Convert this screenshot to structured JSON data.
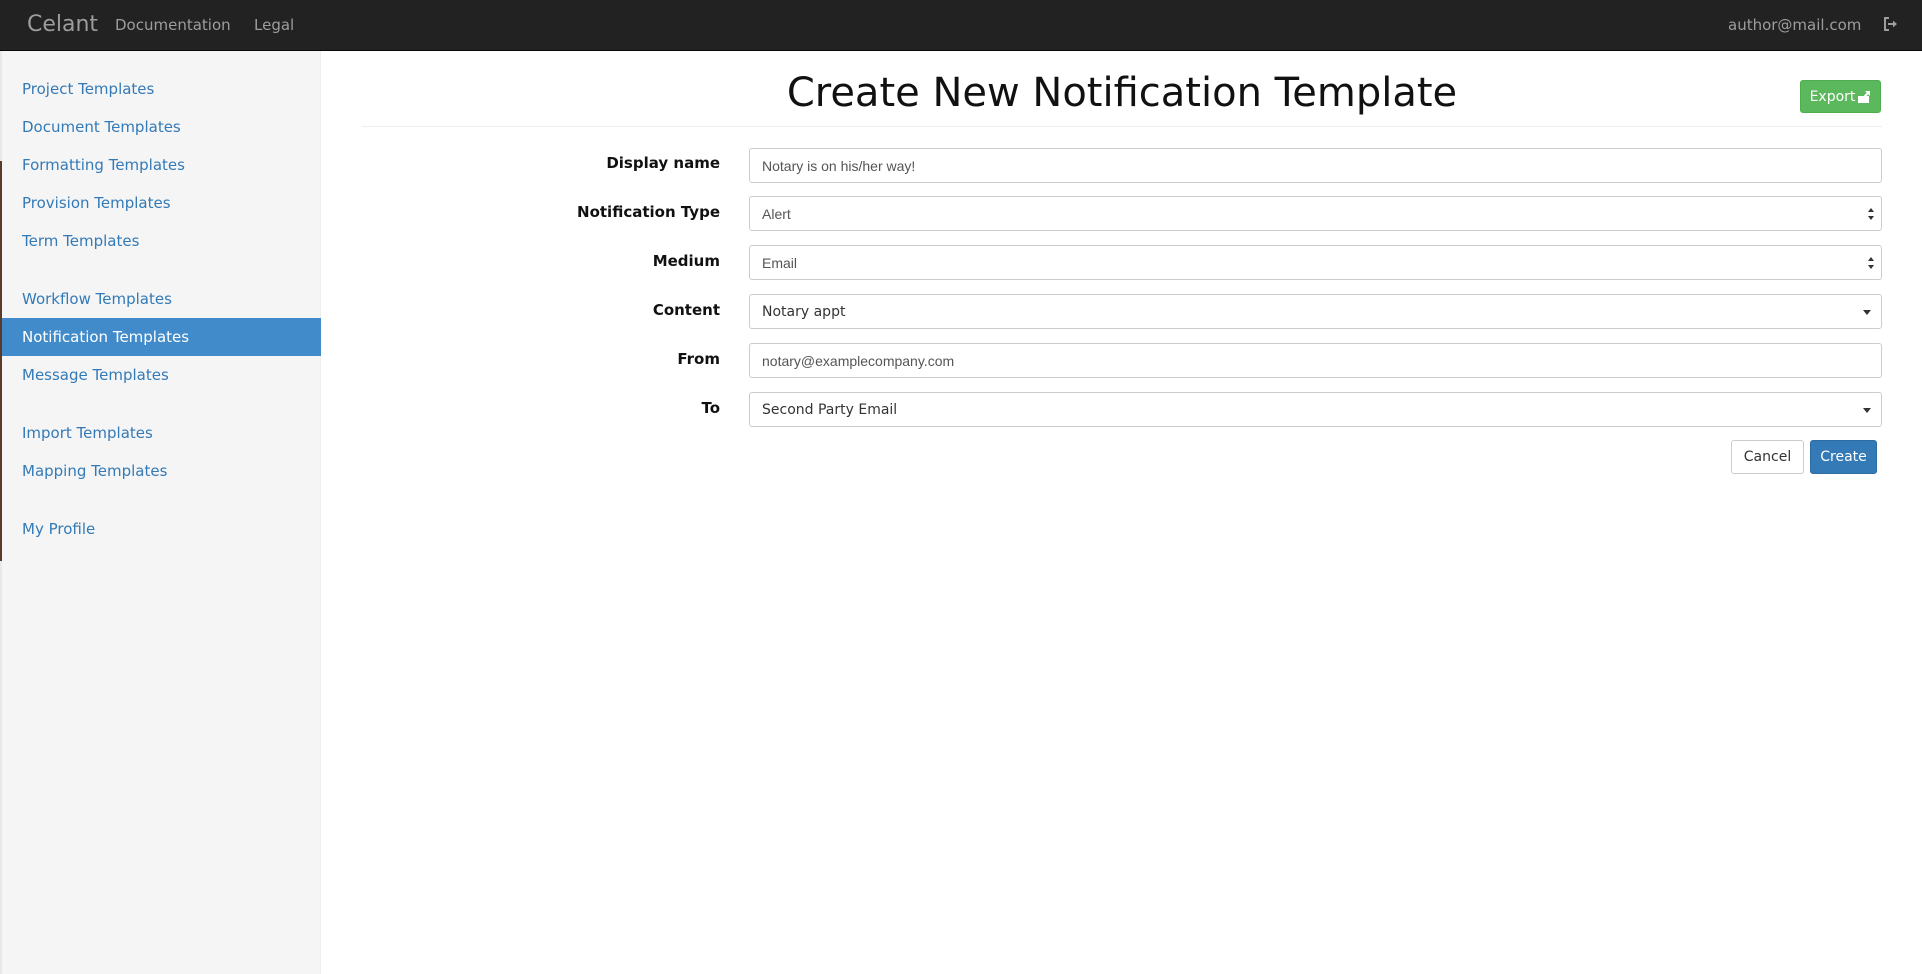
{
  "navbar": {
    "brand": "Celant",
    "links": [
      "Documentation",
      "Legal"
    ],
    "user_email": "author@mail.com",
    "logout_icon": "sign-out-icon"
  },
  "sidebar": {
    "items": [
      {
        "label": "Project Templates",
        "active": false
      },
      {
        "label": "Document Templates",
        "active": false
      },
      {
        "label": "Formatting Templates",
        "active": false
      },
      {
        "label": "Provision Templates",
        "active": false
      },
      {
        "label": "Term Templates",
        "active": false
      },
      {
        "label": "Workflow Templates",
        "active": false
      },
      {
        "label": "Notification Templates",
        "active": true
      },
      {
        "label": "Message Templates",
        "active": false
      },
      {
        "label": "Import Templates",
        "active": false
      },
      {
        "label": "Mapping Templates",
        "active": false
      },
      {
        "label": "My Profile",
        "active": false
      }
    ],
    "active_color": "#428bca"
  },
  "main": {
    "title": "Create New Notification Template",
    "export_label": "Export",
    "export_icon": "export-icon",
    "form": {
      "display_name": {
        "label": "Display name",
        "value": "Notary is on his/her way!"
      },
      "notification_type": {
        "label": "Notification Type",
        "value": "Alert"
      },
      "medium": {
        "label": "Medium",
        "value": "Email"
      },
      "content": {
        "label": "Content",
        "value": "Notary appt"
      },
      "from": {
        "label": "From",
        "value": "notary@examplecompany.com"
      },
      "to": {
        "label": "To",
        "value": "Second Party Email"
      }
    },
    "cancel_label": "Cancel",
    "create_label": "Create"
  },
  "colors": {
    "navbar_bg": "#222222",
    "link": "#337ab7",
    "export_green": "#5cb85c",
    "primary_blue": "#337ab7"
  }
}
